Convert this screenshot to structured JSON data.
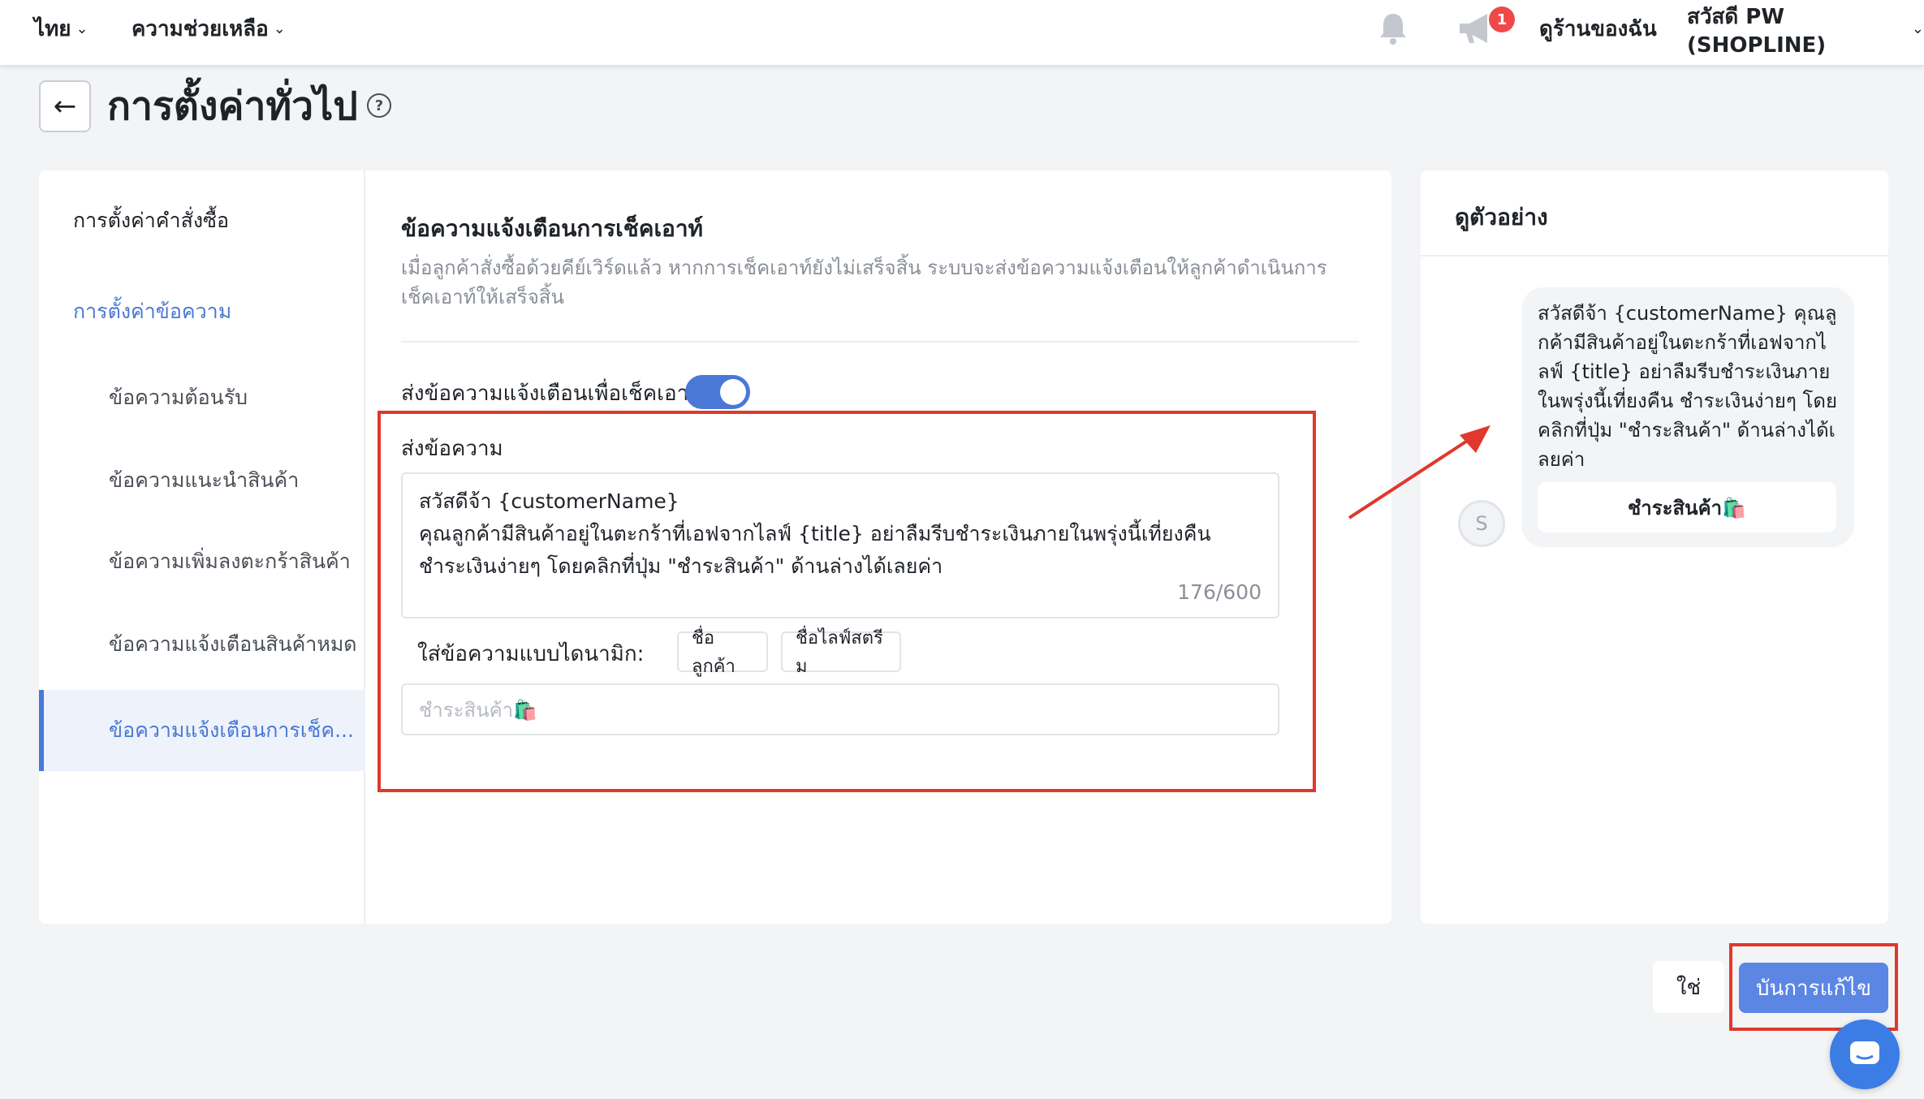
{
  "topbar": {
    "language": "ไทย",
    "help": "ความช่วยเหลือ",
    "notification_count": "1",
    "my_store": "ดูร้านของฉัน",
    "user_greeting": "สวัสดี PW (SHOPLINE)"
  },
  "page": {
    "title": "การตั้งค่าทั่วไป"
  },
  "sidebar": {
    "items": [
      {
        "label": "การตั้งค่าคำสั่งซื้อ"
      },
      {
        "label": "การตั้งค่าข้อความ"
      },
      {
        "label": "ข้อความต้อนรับ"
      },
      {
        "label": "ข้อความแนะนำสินค้า"
      },
      {
        "label": "ข้อความเพิ่มลงตะกร้าสินค้า"
      },
      {
        "label": "ข้อความแจ้งเตือนสินค้าหมด"
      },
      {
        "label": "ข้อความแจ้งเตือนการเช็ค..."
      }
    ]
  },
  "section": {
    "title": "ข้อความแจ้งเตือนการเช็คเอาท์",
    "description": "เมื่อลูกค้าสั่งซื้อด้วยคีย์เวิร์ดแล้ว หากการเช็คเอาท์ยังไม่เสร็จสิ้น ระบบจะส่งข้อความแจ้งเตือนให้ลูกค้าดำเนินการเช็คเอาท์ให้เสร็จสิ้น",
    "toggle_label": "ส่งข้อความแจ้งเตือนเพื่อเช็คเอาท์",
    "toggle_on": true,
    "send_label": "ส่งข้อความ",
    "message_line1": "สวัสดีจ้า {customerName}",
    "message_line2": "คุณลูกค้ามีสินค้าอยู่ในตะกร้าที่เอฟจากไลฟ์ {title} อย่าลืมรีบชำระเงินภายในพรุ่งนี้เที่ยงคืน ชำระเงินง่ายๆ โดยคลิกที่ปุ่ม \"ชำระสินค้า\" ด้านล่างได้เลยค่า",
    "counter": "176/600",
    "dynamic_label": "ใส่ข้อความแบบไดนามิก:",
    "chips": [
      "ชื่อลูกค้า",
      "ชื่อไลฟ์สตรีม"
    ],
    "button_text_placeholder": "ชำระสินค้า🛍️"
  },
  "preview": {
    "title": "ดูตัวอย่าง",
    "avatar_letter": "S",
    "bubble_text": "สวัสดีจ้า {customerName} คุณลูกค้ามีสินค้าอยู่ในตะกร้าที่เอฟจากไลฟ์ {title} อย่าลืมรีบชำระเงินภายในพรุ่งนี้เที่ยงคืน ชำระเงินง่ายๆ โดยคลิกที่ปุ่ม \"ชำระสินค้า\" ด้านล่างได้เลยค่า",
    "bubble_button": "ชำระสินค้า🛍️"
  },
  "footer": {
    "cancel": "ใช่",
    "save": "บันการแก้ไข"
  },
  "colors": {
    "primary": "#4a78d6",
    "save_button": "#5b86e3",
    "highlight": "#e0382c",
    "badge": "#f04848"
  }
}
